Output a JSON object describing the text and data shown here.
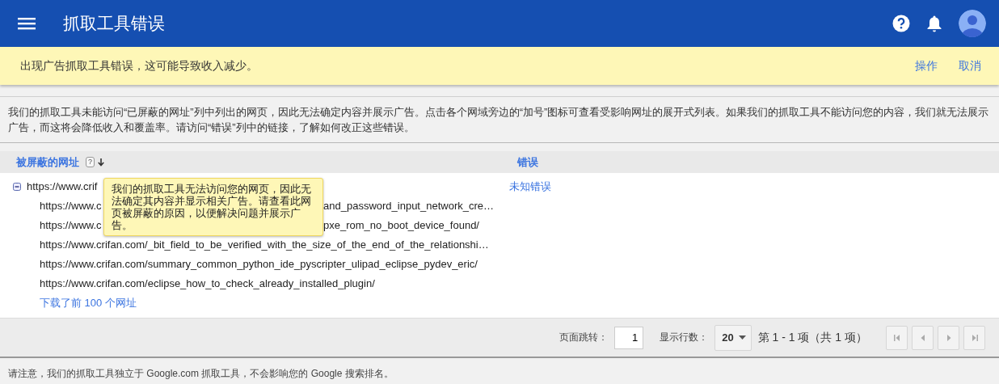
{
  "app_bar": {
    "title": "抓取工具错误"
  },
  "banner": {
    "message": "出现广告抓取工具错误，这可能导致收入减少。",
    "actions": [
      "操作",
      "取消"
    ]
  },
  "description": "我们的抓取工具未能访问“已屏蔽的网址”列中列出的网页，因此无法确定内容并展示广告。点击各个网域旁边的“加号”图标可查看受影响网址的展开式列表。如果我们的抓取工具不能访问您的内容，我们就无法展示广告，而这将会降低收入和覆盖率。请访问“错误”列中的链接，了解如何改正这些错误。",
  "table": {
    "columns": [
      {
        "label": "被屏蔽的网址",
        "help": "?",
        "sort_descending": true
      },
      {
        "label": "错误"
      }
    ],
    "rows": [
      {
        "url_parts": [
          "https://www.crif"
        ],
        "expanded": true,
        "error": "未知错误",
        "children": [
          {
            "url_parts": [
              "https://www.c",
              "and_password_input_network_cre…"
            ]
          },
          {
            "url_parts": [
              "https://www.c",
              "pxe_rom_no_boot_device_found/"
            ]
          },
          {
            "url_parts": [
              "https://www.crifan.com/_bit_field_to_be_verified_with_the_size_of_the_end_of_the_relationshi…"
            ]
          },
          {
            "url_parts": [
              "https://www.crifan.com/summary_common_python_ide_pyscripter_ulipad_eclipse_pydev_eric/"
            ]
          },
          {
            "url_parts": [
              "https://www.crifan.com/eclipse_how_to_check_already_installed_plugin/"
            ]
          }
        ]
      }
    ],
    "download_link": "下载了前 100 个网址",
    "tooltip": {
      "text": "我们的抓取工具无法访问您的网页，因此无法确定其内容并显示相关广告。请查看此网页被屏蔽的原因，以便解决问题并展示广告。"
    }
  },
  "pagination": {
    "jump_label": "页面跳转：",
    "page": "1",
    "rows_label": "显示行数：",
    "rows_per_page": "20",
    "range": "第 1 - 1 项（共 1 项）",
    "buttons": [
      {
        "kind": "first",
        "disabled": true
      },
      {
        "kind": "prev",
        "disabled": true
      },
      {
        "kind": "next",
        "disabled": true
      },
      {
        "kind": "last",
        "disabled": true
      }
    ]
  },
  "footer_note": "请注意，我们的抓取工具独立于 Google.com 抓取工具，不会影响您的 Google 搜索排名。"
}
